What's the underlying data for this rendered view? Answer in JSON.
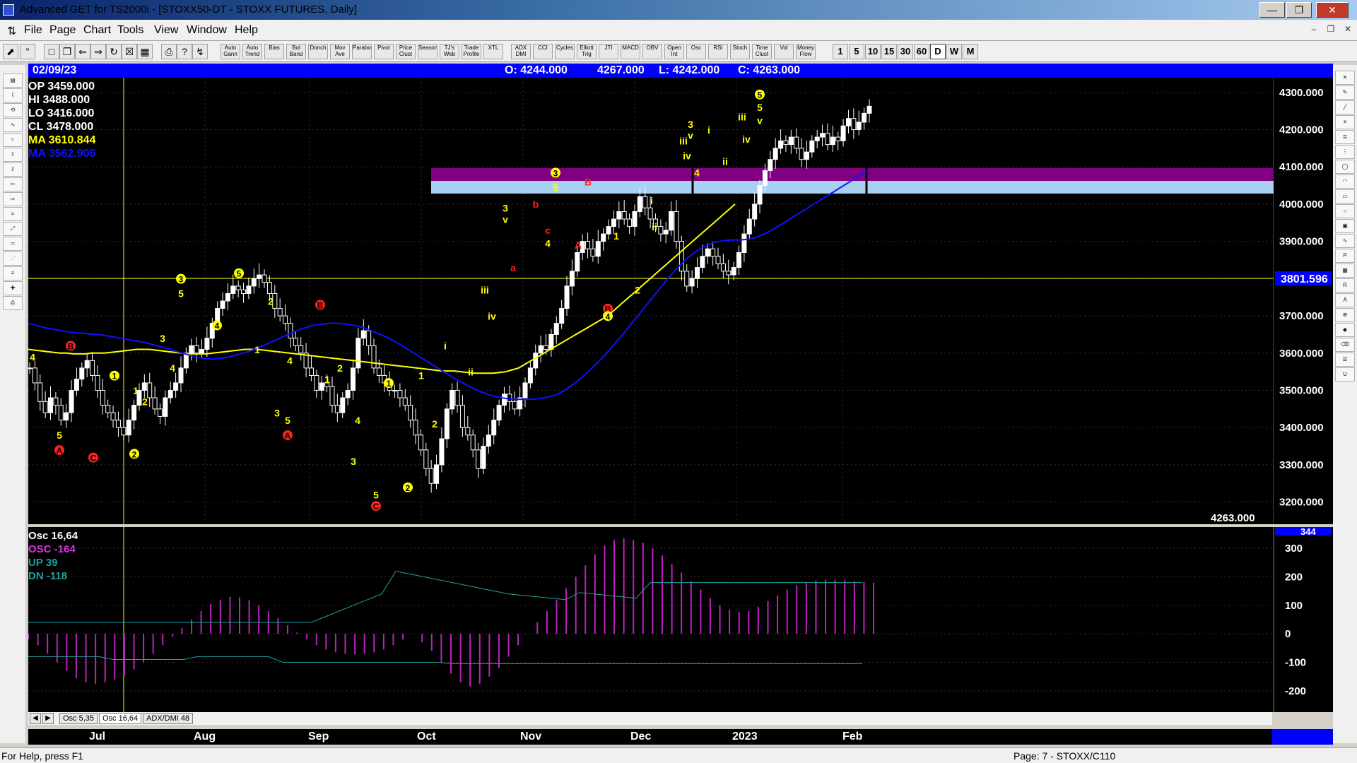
{
  "window": {
    "title": "Advanced GET for TS2000i - [STOXX50-DT - STOXX FUTURES, Daily]"
  },
  "menu": [
    "File",
    "Page",
    "Chart",
    "Tools",
    "View",
    "Window",
    "Help"
  ],
  "toolbar": {
    "studies": [
      "Auto Gann",
      "Auto Trend",
      "Bias",
      "Bol Band",
      "Donch",
      "Mov Ave",
      "Parabolic",
      "Pivot",
      "Price Clust",
      "Seasonal",
      "TJ's Web",
      "Trade Profile",
      "XTL",
      "ADX DMI",
      "CCI",
      "Cycles",
      "Elliott Trig",
      "JTI",
      "MACD",
      "OBV",
      "Open Int",
      "Osc",
      "RSI",
      "Stoch",
      "Time Clust",
      "Vol",
      "Money Flow"
    ],
    "periods": [
      "1",
      "5",
      "10",
      "15",
      "30",
      "60",
      "D",
      "W",
      "M"
    ],
    "active_period": "D"
  },
  "infobar": {
    "date": "02/09/23",
    "open": "O: 4244.000",
    "high": "4267.000",
    "low": "L: 4242.000",
    "close": "C: 4263.000"
  },
  "readout": {
    "op": "OP 3459.000",
    "hi": "HI 3488.000",
    "lo": "LO 3416.000",
    "cl": "CL 3478.000",
    "ma1": "MA 3610.844",
    "ma2": "MA 3562.906"
  },
  "osc_readout": {
    "title": "Osc 16,64",
    "osc": "OSC -164",
    "up": "UP 39",
    "dn": "DN -118"
  },
  "price_line": "3801.596",
  "last_price": "4263.000",
  "osc_top_label": "344",
  "tabs": [
    "Osc 5,35",
    "Osc 16,64",
    "ADX/DMI 48"
  ],
  "active_tab": "Osc 16,64",
  "months": [
    "Jul",
    "Aug",
    "Sep",
    "Oct",
    "Nov",
    "Dec",
    "2023",
    "Feb"
  ],
  "status": {
    "help": "For Help, press F1",
    "page": "Page: 7 - STOXX/C110"
  },
  "colors": {
    "up_bar": "#ffffff",
    "ma_fast": "#ffff00",
    "ma_slow": "#1010ff",
    "osc": "#c020c0",
    "band_top": "#800080",
    "band_bottom": "#a8d0f0",
    "hline": "#ffff00"
  },
  "chart_data": {
    "type": "candlestick",
    "ylim": [
      3150,
      4330
    ],
    "yticks": [
      "4300.000",
      "4200.000",
      "4100.000",
      "4000.000",
      "3900.000",
      "3800.000",
      "3700.000",
      "3600.000",
      "3500.000",
      "3400.000",
      "3300.000",
      "3200.000"
    ],
    "close": [
      3560,
      3520,
      3470,
      3440,
      3480,
      3460,
      3420,
      3440,
      3500,
      3530,
      3560,
      3580,
      3540,
      3500,
      3460,
      3440,
      3420,
      3400,
      3380,
      3420,
      3460,
      3500,
      3520,
      3480,
      3450,
      3430,
      3480,
      3500,
      3520,
      3560,
      3600,
      3620,
      3600,
      3610,
      3640,
      3680,
      3720,
      3740,
      3760,
      3780,
      3770,
      3760,
      3780,
      3800,
      3810,
      3790,
      3760,
      3720,
      3700,
      3680,
      3640,
      3620,
      3600,
      3560,
      3540,
      3500,
      3520,
      3510,
      3460,
      3440,
      3480,
      3500,
      3560,
      3640,
      3660,
      3620,
      3560,
      3540,
      3520,
      3500,
      3500,
      3480,
      3460,
      3420,
      3380,
      3340,
      3290,
      3250,
      3300,
      3370,
      3450,
      3500,
      3460,
      3400,
      3380,
      3340,
      3290,
      3350,
      3380,
      3420,
      3460,
      3490,
      3470,
      3450,
      3480,
      3520,
      3560,
      3600,
      3620,
      3610,
      3650,
      3680,
      3720,
      3780,
      3820,
      3870,
      3900,
      3880,
      3860,
      3900,
      3920,
      3940,
      3960,
      3980,
      3960,
      3940,
      3980,
      4020,
      3990,
      3960,
      3940,
      3920,
      3930,
      3980,
      3900,
      3820,
      3780,
      3800,
      3830,
      3860,
      3880,
      3860,
      3840,
      3820,
      3810,
      3830,
      3870,
      3920,
      3960,
      4000,
      4050,
      4090,
      4120,
      4150,
      4170,
      4160,
      4180,
      4150,
      4120,
      4140,
      4170,
      4180,
      4190,
      4160,
      4180,
      4170,
      4210,
      4230,
      4200,
      4220,
      4244,
      4263
    ],
    "ma_fast": [
      3610,
      3608,
      3606,
      3604,
      3602,
      3600,
      3600,
      3598,
      3598,
      3598,
      3600,
      3600,
      3600,
      3602,
      3604,
      3606,
      3608,
      3610,
      3610,
      3610,
      3608,
      3606,
      3604,
      3602,
      3600,
      3598,
      3598,
      3598,
      3598,
      3600,
      3602,
      3604,
      3606,
      3608,
      3610,
      3610,
      3610,
      3608,
      3606,
      3604,
      3602,
      3600,
      3598,
      3596,
      3594,
      3592,
      3590,
      3588,
      3586,
      3584,
      3582,
      3580,
      3578,
      3576,
      3574,
      3572,
      3570,
      3568,
      3566,
      3564,
      3562,
      3560,
      3558,
      3556,
      3554,
      3552,
      3552,
      3552,
      3550,
      3548,
      3546,
      3546,
      3546,
      3546,
      3548,
      3550,
      3555,
      3560,
      3570,
      3580,
      3590,
      3600,
      3610,
      3620,
      3630,
      3640,
      3650,
      3660,
      3670,
      3680,
      3690,
      3700,
      3715,
      3730,
      3745,
      3760,
      3775,
      3790,
      3805,
      3820,
      3835,
      3850,
      3865,
      3880,
      3895,
      3910,
      3925,
      3940,
      3955,
      3970,
      3985,
      4000
    ],
    "ma_slow": [
      3680,
      3674,
      3668,
      3664,
      3660,
      3656,
      3654,
      3652,
      3650,
      3648,
      3644,
      3640,
      3636,
      3632,
      3628,
      3622,
      3616,
      3610,
      3602,
      3596,
      3590,
      3586,
      3584,
      3586,
      3590,
      3596,
      3602,
      3610,
      3620,
      3630,
      3640,
      3650,
      3660,
      3668,
      3674,
      3678,
      3680,
      3680,
      3678,
      3674,
      3668,
      3660,
      3650,
      3640,
      3628,
      3614,
      3600,
      3586,
      3572,
      3558,
      3544,
      3530,
      3518,
      3506,
      3496,
      3488,
      3482,
      3478,
      3476,
      3476,
      3476,
      3478,
      3482,
      3488,
      3500,
      3516,
      3534,
      3554,
      3576,
      3600,
      3626,
      3652,
      3680,
      3708,
      3736,
      3764,
      3792,
      3818,
      3842,
      3862,
      3878,
      3890,
      3898,
      3902,
      3904,
      3904,
      3906,
      3912,
      3922,
      3934,
      3948,
      3962,
      3976,
      3990,
      4004,
      4018,
      4032,
      4046,
      4060,
      4074,
      4090
    ],
    "osc": [
      -20,
      -40,
      -70,
      -100,
      -130,
      -155,
      -170,
      -175,
      -170,
      -160,
      -145,
      -125,
      -100,
      -70,
      -40,
      -10,
      20,
      50,
      80,
      105,
      120,
      130,
      128,
      118,
      100,
      80,
      55,
      30,
      5,
      -20,
      -40,
      -55,
      -65,
      -70,
      -72,
      -70,
      -65,
      -55,
      -40,
      -20,
      0,
      -30,
      -60,
      -100,
      -140,
      -170,
      -185,
      -175,
      -150,
      -120,
      -80,
      -40,
      0,
      40,
      80,
      120,
      160,
      200,
      240,
      280,
      310,
      330,
      335,
      330,
      320,
      300,
      275,
      245,
      215,
      185,
      155,
      125,
      100,
      85,
      78,
      80,
      95,
      115,
      135,
      155,
      170,
      182,
      188,
      190,
      190,
      188,
      185,
      182,
      180
    ],
    "osc_ticks": [
      "300",
      "200",
      "100",
      "0",
      "-100",
      "-200"
    ],
    "wave_labels": [
      "1",
      "2",
      "3",
      "4",
      "5",
      "A",
      "B",
      "C",
      "a",
      "b",
      "c",
      "i",
      "ii",
      "iii",
      "iv",
      "v"
    ]
  }
}
